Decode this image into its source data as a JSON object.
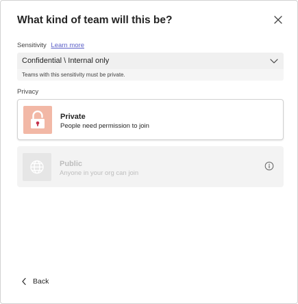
{
  "dialog": {
    "title": "What kind of team will this be?"
  },
  "sensitivity": {
    "label": "Sensitivity",
    "learn_more": "Learn more",
    "selected": "Confidential \\ Internal only",
    "note": "Teams with this sensitivity must be private."
  },
  "privacy": {
    "label": "Privacy",
    "options": [
      {
        "title": "Private",
        "description": "People need permission to join",
        "icon": "lock-icon",
        "enabled": true
      },
      {
        "title": "Public",
        "description": "Anyone in your org can join",
        "icon": "globe-icon",
        "enabled": false
      }
    ]
  },
  "footer": {
    "back_label": "Back"
  },
  "colors": {
    "link": "#5b5fc7",
    "lock_tile": "#f2b8a6",
    "lock_icon": "#c4314b",
    "disabled_text": "#bdbdbd"
  }
}
